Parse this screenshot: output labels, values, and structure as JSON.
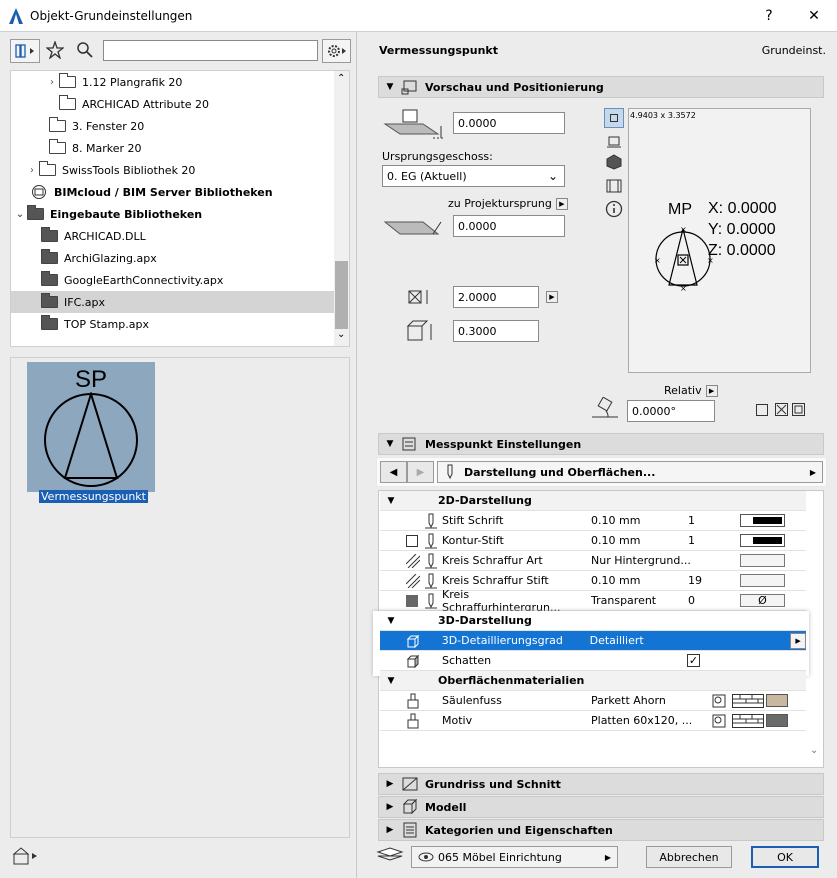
{
  "window": {
    "title": "Objekt-Grundeinstellungen",
    "help": "?",
    "close": "✕"
  },
  "library": {
    "search_placeholder": "",
    "items": [
      {
        "label": "1.12 Plangrafik 20",
        "type": "folder"
      },
      {
        "label": "ARCHICAD Attribute 20",
        "type": "folder"
      },
      {
        "label": "3. Fenster 20",
        "type": "folder"
      },
      {
        "label": "8. Marker 20",
        "type": "folder"
      },
      {
        "label": "SwissTools Bibliothek 20",
        "type": "folder"
      },
      {
        "label": "BIMcloud / BIM Server Bibliotheken",
        "type": "bimcloud"
      },
      {
        "label": "Eingebaute Bibliotheken",
        "type": "folder-dark"
      },
      {
        "label": "ARCHICAD.DLL",
        "type": "folder-dark"
      },
      {
        "label": "ArchiGlazing.apx",
        "type": "folder-dark"
      },
      {
        "label": "GoogleEarthConnectivity.apx",
        "type": "folder-dark"
      },
      {
        "label": "IFC.apx",
        "type": "folder-dark"
      },
      {
        "label": "TOP Stamp.apx",
        "type": "folder-dark"
      }
    ],
    "preview": {
      "label": "SP",
      "caption": "Vermessungspunkt"
    }
  },
  "header": {
    "object_name": "Vermessungspunkt",
    "mode": "Grundeinst."
  },
  "sections": {
    "preview": "Vorschau und Positionierung",
    "messpunkt": "Messpunkt Einstellungen",
    "grundriss": "Grundriss und Schnitt",
    "modell": "Modell",
    "kategorien": "Kategorien und Eigenschaften"
  },
  "positioning": {
    "elevation": "0.0000",
    "story_label": "Ursprungsgeschoss:",
    "story_value": "0. EG (Aktuell)",
    "project_origin_label": "zu Projektursprung",
    "project_origin_value": "0.0000",
    "size_a": "2.0000",
    "size_b": "0.3000",
    "dims": "4.9403 x 3.3572",
    "relative_label": "Relativ",
    "angle": "0.0000°"
  },
  "symbol_preview": {
    "mp": "MP",
    "x": "X: 0.0000",
    "y": "Y: 0.0000",
    "z": "Z: 0.0000"
  },
  "page_selector": "Darstellung und Oberflächen...",
  "params": [
    {
      "kind": "hdr",
      "name": "2D-Darstellung",
      "open": true
    },
    {
      "kind": "row",
      "icon": "pen",
      "name": "Stift Schrift",
      "value": "0.10 mm",
      "num": "1",
      "swatch": "pen"
    },
    {
      "kind": "row",
      "icon": "square-pen",
      "name": "Kontur-Stift",
      "value": "0.10 mm",
      "num": "1",
      "swatch": "pen"
    },
    {
      "kind": "row",
      "icon": "hatch-pen",
      "name": "Kreis Schraffur Art",
      "value": "Nur Hintergrund...",
      "num": "",
      "swatch": "blank"
    },
    {
      "kind": "row",
      "icon": "hatch-pen",
      "name": "Kreis Schraffur Stift",
      "value": "0.10 mm",
      "num": "19",
      "swatch": "blank"
    },
    {
      "kind": "row",
      "icon": "fill-pen",
      "name": "Kreis Schraffurhintergrun...",
      "value": "Transparent",
      "num": "0",
      "swatch": "empty-set"
    },
    {
      "kind": "hdr",
      "name": "3D-Darstellung",
      "open": true
    },
    {
      "kind": "row",
      "icon": "cube",
      "name": "3D-Detaillierungsgrad",
      "value": "Detailliert",
      "selected": true
    },
    {
      "kind": "row",
      "icon": "cube-shadow",
      "name": "Schatten",
      "value": "",
      "check": true
    },
    {
      "kind": "hdr",
      "name": "Oberflächenmaterialien",
      "open": true
    },
    {
      "kind": "row",
      "icon": "brush",
      "name": "Säulenfuss",
      "value": "Parkett Ahorn",
      "material": "#c8b8a0"
    },
    {
      "kind": "row",
      "icon": "brush",
      "name": "Motiv",
      "value": "Platten 60x120, ...",
      "material": "#6a6a6a"
    }
  ],
  "footer": {
    "layer": "065 Möbel Einrichtung",
    "cancel": "Abbrechen",
    "ok": "OK",
    "empty_set": "Ø",
    "check": "✓"
  }
}
